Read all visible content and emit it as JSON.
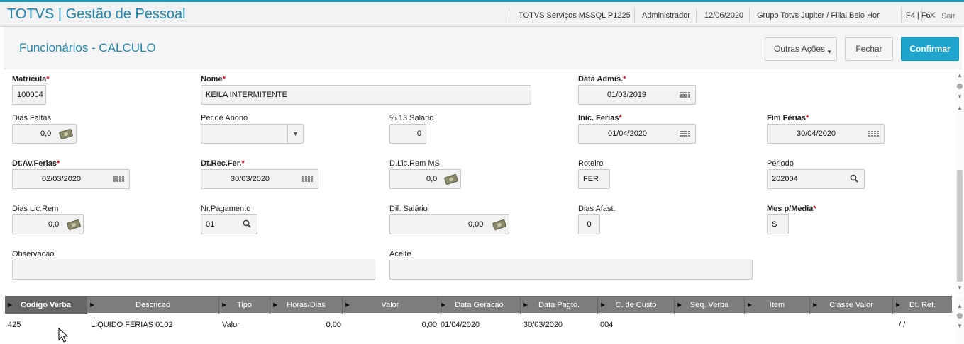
{
  "topbar": {
    "app_title": "TOTVS | Gestão de Pessoal",
    "environment": "TOTVS Serviços MSSQL P1225",
    "user": "Administrador",
    "date": "12/06/2020",
    "branch": "Grupo Totvs Jupiter / Filial Belo Hor",
    "shortcuts": "F4 | F6",
    "exit_label": "Sair"
  },
  "header": {
    "title": "Funcionários - CALCULO",
    "more_actions_label": "Outras Ações",
    "close_label": "Fechar",
    "confirm_label": "Confirmar"
  },
  "form": {
    "matricula": {
      "label": "Matricula",
      "value": "100004"
    },
    "nome": {
      "label": "Nome",
      "value": "KEILA INTERMITENTE"
    },
    "data_admis": {
      "label": "Data Admis.",
      "value": "01/03/2019"
    },
    "dias_faltas": {
      "label": "Dias Faltas",
      "value": "0,0"
    },
    "per_abono": {
      "label": "Per.de Abono",
      "value": ""
    },
    "pct_13": {
      "label": "% 13 Salario",
      "value": "0"
    },
    "inic_ferias": {
      "label": "Inic. Ferias",
      "value": "01/04/2020"
    },
    "fim_ferias": {
      "label": "Fim Férias",
      "value": "30/04/2020"
    },
    "dt_av_ferias": {
      "label": "Dt.Av.Ferias",
      "value": "02/03/2020"
    },
    "dt_rec_fer": {
      "label": "Dt.Rec.Fer.",
      "value": "30/03/2020"
    },
    "d_lic_rem_ms": {
      "label": "D.Lic.Rem MS",
      "value": "0,0"
    },
    "roteiro": {
      "label": "Roteiro",
      "value": "FER"
    },
    "periodo": {
      "label": "Periodo",
      "value": "202004"
    },
    "dias_lic_rem": {
      "label": "Dias Lic.Rem",
      "value": "0,0"
    },
    "nr_pagamento": {
      "label": "Nr.Pagamento",
      "value": "01"
    },
    "dif_salario": {
      "label": "Dif. Salário",
      "value": "0,00"
    },
    "dias_afast": {
      "label": "Dias Afast.",
      "value": "0"
    },
    "mes_media": {
      "label": "Mes p/Media",
      "value": "S"
    },
    "observacao": {
      "label": "Observacao",
      "value": ""
    },
    "aceite": {
      "label": "Aceite",
      "value": ""
    }
  },
  "grid": {
    "columns": [
      "Codigo Verba",
      "Descricao",
      "Tipo",
      "Horas/Dias",
      "Valor",
      "Data Geracao",
      "Data Pagto.",
      "C. de Custo",
      "Seq. Verba",
      "Item",
      "Classe Valor",
      "Dt. Ref."
    ],
    "rows": [
      [
        "425",
        "LIQUIDO FERIAS 0102",
        "Valor",
        "0,00",
        "0,00",
        "01/04/2020",
        "30/03/2020",
        "004",
        "",
        "",
        "",
        "/ /"
      ]
    ]
  }
}
